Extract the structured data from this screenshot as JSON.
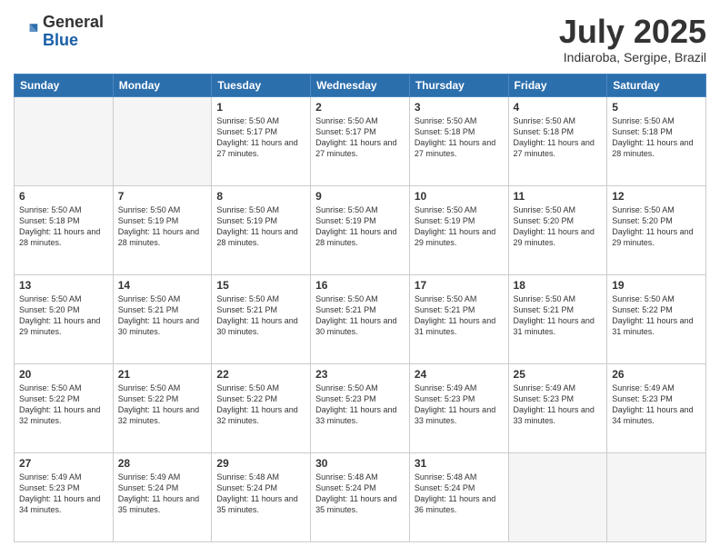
{
  "header": {
    "logo_general": "General",
    "logo_blue": "Blue",
    "month": "July 2025",
    "location": "Indiaroba, Sergipe, Brazil"
  },
  "days_of_week": [
    "Sunday",
    "Monday",
    "Tuesday",
    "Wednesday",
    "Thursday",
    "Friday",
    "Saturday"
  ],
  "weeks": [
    [
      {
        "day": "",
        "info": ""
      },
      {
        "day": "",
        "info": ""
      },
      {
        "day": "1",
        "info": "Sunrise: 5:50 AM\nSunset: 5:17 PM\nDaylight: 11 hours and 27 minutes."
      },
      {
        "day": "2",
        "info": "Sunrise: 5:50 AM\nSunset: 5:17 PM\nDaylight: 11 hours and 27 minutes."
      },
      {
        "day": "3",
        "info": "Sunrise: 5:50 AM\nSunset: 5:18 PM\nDaylight: 11 hours and 27 minutes."
      },
      {
        "day": "4",
        "info": "Sunrise: 5:50 AM\nSunset: 5:18 PM\nDaylight: 11 hours and 27 minutes."
      },
      {
        "day": "5",
        "info": "Sunrise: 5:50 AM\nSunset: 5:18 PM\nDaylight: 11 hours and 28 minutes."
      }
    ],
    [
      {
        "day": "6",
        "info": "Sunrise: 5:50 AM\nSunset: 5:18 PM\nDaylight: 11 hours and 28 minutes."
      },
      {
        "day": "7",
        "info": "Sunrise: 5:50 AM\nSunset: 5:19 PM\nDaylight: 11 hours and 28 minutes."
      },
      {
        "day": "8",
        "info": "Sunrise: 5:50 AM\nSunset: 5:19 PM\nDaylight: 11 hours and 28 minutes."
      },
      {
        "day": "9",
        "info": "Sunrise: 5:50 AM\nSunset: 5:19 PM\nDaylight: 11 hours and 28 minutes."
      },
      {
        "day": "10",
        "info": "Sunrise: 5:50 AM\nSunset: 5:19 PM\nDaylight: 11 hours and 29 minutes."
      },
      {
        "day": "11",
        "info": "Sunrise: 5:50 AM\nSunset: 5:20 PM\nDaylight: 11 hours and 29 minutes."
      },
      {
        "day": "12",
        "info": "Sunrise: 5:50 AM\nSunset: 5:20 PM\nDaylight: 11 hours and 29 minutes."
      }
    ],
    [
      {
        "day": "13",
        "info": "Sunrise: 5:50 AM\nSunset: 5:20 PM\nDaylight: 11 hours and 29 minutes."
      },
      {
        "day": "14",
        "info": "Sunrise: 5:50 AM\nSunset: 5:21 PM\nDaylight: 11 hours and 30 minutes."
      },
      {
        "day": "15",
        "info": "Sunrise: 5:50 AM\nSunset: 5:21 PM\nDaylight: 11 hours and 30 minutes."
      },
      {
        "day": "16",
        "info": "Sunrise: 5:50 AM\nSunset: 5:21 PM\nDaylight: 11 hours and 30 minutes."
      },
      {
        "day": "17",
        "info": "Sunrise: 5:50 AM\nSunset: 5:21 PM\nDaylight: 11 hours and 31 minutes."
      },
      {
        "day": "18",
        "info": "Sunrise: 5:50 AM\nSunset: 5:21 PM\nDaylight: 11 hours and 31 minutes."
      },
      {
        "day": "19",
        "info": "Sunrise: 5:50 AM\nSunset: 5:22 PM\nDaylight: 11 hours and 31 minutes."
      }
    ],
    [
      {
        "day": "20",
        "info": "Sunrise: 5:50 AM\nSunset: 5:22 PM\nDaylight: 11 hours and 32 minutes."
      },
      {
        "day": "21",
        "info": "Sunrise: 5:50 AM\nSunset: 5:22 PM\nDaylight: 11 hours and 32 minutes."
      },
      {
        "day": "22",
        "info": "Sunrise: 5:50 AM\nSunset: 5:22 PM\nDaylight: 11 hours and 32 minutes."
      },
      {
        "day": "23",
        "info": "Sunrise: 5:50 AM\nSunset: 5:23 PM\nDaylight: 11 hours and 33 minutes."
      },
      {
        "day": "24",
        "info": "Sunrise: 5:49 AM\nSunset: 5:23 PM\nDaylight: 11 hours and 33 minutes."
      },
      {
        "day": "25",
        "info": "Sunrise: 5:49 AM\nSunset: 5:23 PM\nDaylight: 11 hours and 33 minutes."
      },
      {
        "day": "26",
        "info": "Sunrise: 5:49 AM\nSunset: 5:23 PM\nDaylight: 11 hours and 34 minutes."
      }
    ],
    [
      {
        "day": "27",
        "info": "Sunrise: 5:49 AM\nSunset: 5:23 PM\nDaylight: 11 hours and 34 minutes."
      },
      {
        "day": "28",
        "info": "Sunrise: 5:49 AM\nSunset: 5:24 PM\nDaylight: 11 hours and 35 minutes."
      },
      {
        "day": "29",
        "info": "Sunrise: 5:48 AM\nSunset: 5:24 PM\nDaylight: 11 hours and 35 minutes."
      },
      {
        "day": "30",
        "info": "Sunrise: 5:48 AM\nSunset: 5:24 PM\nDaylight: 11 hours and 35 minutes."
      },
      {
        "day": "31",
        "info": "Sunrise: 5:48 AM\nSunset: 5:24 PM\nDaylight: 11 hours and 36 minutes."
      },
      {
        "day": "",
        "info": ""
      },
      {
        "day": "",
        "info": ""
      }
    ]
  ]
}
